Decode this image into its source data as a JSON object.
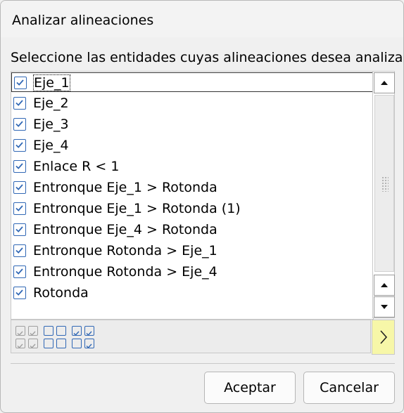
{
  "dialog": {
    "title": "Analizar alineaciones",
    "instruction": "Seleccione las entidades cuyas alineaciones desea analizar:"
  },
  "list": {
    "items": [
      {
        "label": "Eje_1",
        "checked": true
      },
      {
        "label": "Eje_2",
        "checked": true
      },
      {
        "label": "Eje_3",
        "checked": true
      },
      {
        "label": "Eje_4",
        "checked": true
      },
      {
        "label": "Enlace R < 1",
        "checked": true
      },
      {
        "label": "Entronque Eje_1 > Rotonda",
        "checked": true
      },
      {
        "label": "Entronque Eje_1 > Rotonda (1)",
        "checked": true
      },
      {
        "label": "Entronque Eje_4 > Rotonda",
        "checked": true
      },
      {
        "label": "Entronque Rotonda > Eje_1",
        "checked": true
      },
      {
        "label": "Entronque Rotonda > Eje_4",
        "checked": true
      },
      {
        "label": "Rotonda",
        "checked": true
      }
    ]
  },
  "scrollbar": {
    "up_icon": "triangle-up-icon",
    "down_icon": "triangle-down-icon"
  },
  "toolbar": {
    "buttons": [
      {
        "name": "check-all-disabled-icon"
      },
      {
        "name": "uncheck-all-icon"
      },
      {
        "name": "check-selected-icon"
      }
    ],
    "expand_icon": "chevron-right-icon"
  },
  "buttons": {
    "accept": "Aceptar",
    "cancel": "Cancelar"
  },
  "colors": {
    "checkbox": "#3168b5",
    "expand_bg": "#f7f7a8"
  }
}
